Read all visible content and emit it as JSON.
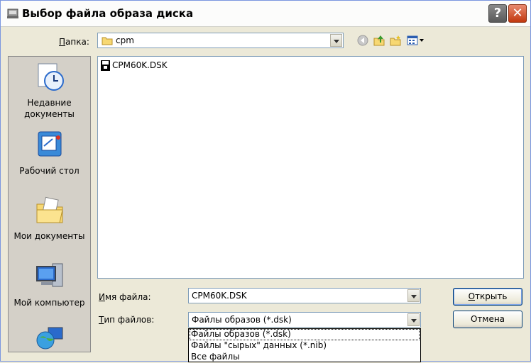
{
  "window": {
    "title": "Выбор файла образа диска",
    "help_label": "?",
    "close_label": "✕"
  },
  "lookin": {
    "label_underlined": "П",
    "label_rest": "апка:",
    "value": "cpm"
  },
  "toolbar": {
    "icons": [
      "back-icon",
      "up-folder-icon",
      "new-folder-icon",
      "view-menu-icon"
    ]
  },
  "places": [
    {
      "label": "Недавние документы",
      "icon": "recent-documents-icon"
    },
    {
      "label": "Рабочий стол",
      "icon": "desktop-icon"
    },
    {
      "label": "Мои документы",
      "icon": "my-documents-icon"
    },
    {
      "label": "Мой компьютер",
      "icon": "my-computer-icon"
    },
    {
      "label": "",
      "icon": "network-places-icon"
    }
  ],
  "files": [
    {
      "name": "CPM60K.DSK",
      "icon": "disk-image-file-icon"
    }
  ],
  "filename": {
    "label_underlined": "И",
    "label_rest": "мя файла:",
    "value": "CPM60K.DSK"
  },
  "filetype": {
    "label_underlined": "Т",
    "label_rest": "ип файлов:",
    "value": "Файлы образов (*.dsk)",
    "options": [
      "Файлы образов (*.dsk)",
      "Файлы \"сырых\" данных (*.nib)",
      "Все файлы"
    ],
    "selected_index": 0
  },
  "buttons": {
    "open_underlined": "О",
    "open_rest": "ткрыть",
    "cancel": "Отмена"
  },
  "colors": {
    "dialog_bg": "#ece9d8",
    "field_border": "#7f9db9",
    "button_border": "#003c74"
  }
}
